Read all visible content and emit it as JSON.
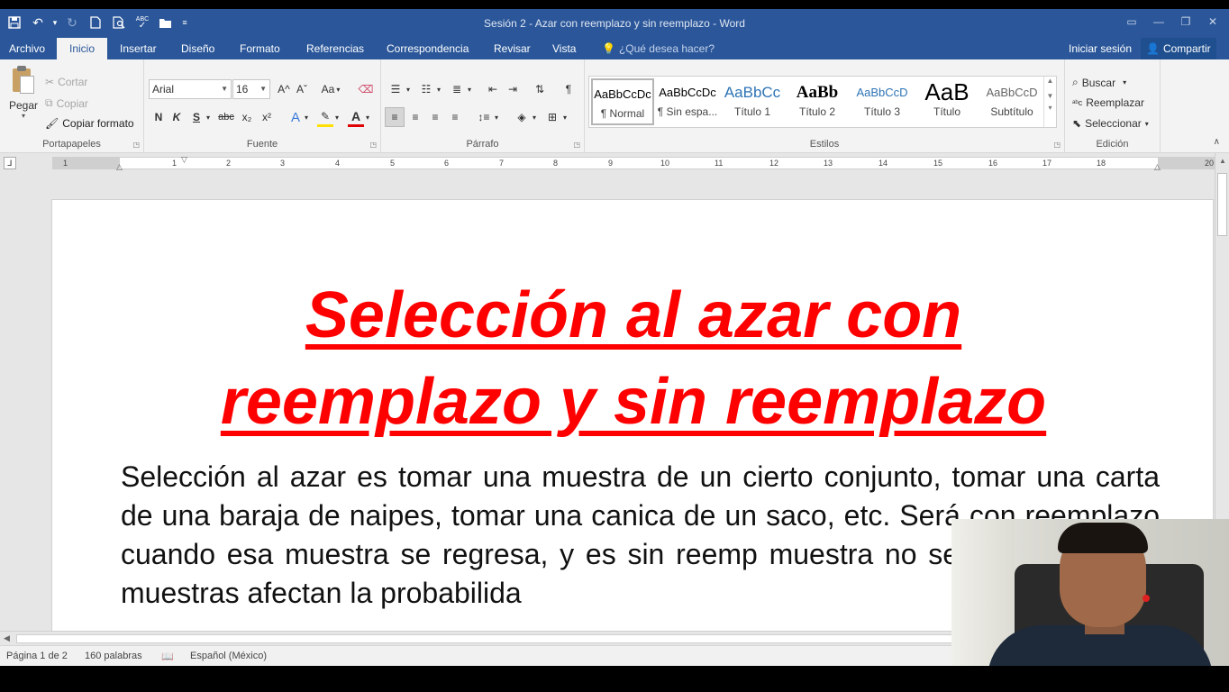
{
  "window": {
    "title": "Sesión 2 - Azar con reemplazo y sin reemplazo - Word"
  },
  "qat": {
    "icons": [
      "save-icon",
      "undo-icon",
      "redo-icon",
      "new-icon",
      "print-preview-icon",
      "spelling-icon",
      "open-icon",
      "customize-icon"
    ],
    "spelling_label": "ABC"
  },
  "tabs": [
    {
      "label": "Archivo"
    },
    {
      "label": "Inicio"
    },
    {
      "label": "Insertar"
    },
    {
      "label": "Diseño"
    },
    {
      "label": "Formato"
    },
    {
      "label": "Referencias"
    },
    {
      "label": "Correspondencia"
    },
    {
      "label": "Revisar"
    },
    {
      "label": "Vista"
    }
  ],
  "tellme": {
    "placeholder": "¿Qué desea hacer?"
  },
  "account": {
    "signin": "Iniciar sesión",
    "share": "Compartir"
  },
  "ribbon": {
    "clipboard": {
      "label": "Portapapeles",
      "paste": "Pegar",
      "cut": "Cortar",
      "copy": "Copiar",
      "format_painter": "Copiar formato"
    },
    "font": {
      "label": "Fuente",
      "family": "Arial",
      "size": "16",
      "bold": "N",
      "italic": "K",
      "underline": "S",
      "strike": "abc",
      "subscript": "x₂",
      "superscript": "x²",
      "grow": "A^",
      "shrink": "Aˇ",
      "change_case": "Aa",
      "effects": "A",
      "color": "A"
    },
    "paragraph": {
      "label": "Párrafo"
    },
    "styles": {
      "label": "Estilos",
      "items": [
        {
          "preview": "AaBbCcDc",
          "name": "¶ Normal"
        },
        {
          "preview": "AaBbCcDc",
          "name": "¶ Sin espa..."
        },
        {
          "preview": "AaBbCc",
          "name": "Título 1"
        },
        {
          "preview": "AaBb",
          "name": "Título 2"
        },
        {
          "preview": "AaBbCcD",
          "name": "Título 3"
        },
        {
          "preview": "AaB",
          "name": "Título"
        },
        {
          "preview": "AaBbCcD",
          "name": "Subtítulo"
        }
      ]
    },
    "editing": {
      "label": "Edición",
      "find": "Buscar",
      "replace": "Reemplazar",
      "select": "Seleccionar"
    }
  },
  "ruler": {
    "ticks": [
      "1",
      "1",
      "2",
      "3",
      "4",
      "5",
      "6",
      "7",
      "8",
      "9",
      "10",
      "11",
      "12",
      "13",
      "14",
      "15",
      "16",
      "17",
      "18",
      "20"
    ]
  },
  "document": {
    "heading_line1": "Selección al azar con",
    "heading_line2": "reemplazo y sin reemplazo",
    "body": "Selección al azar es tomar una muestra de un cierto conjunto, tomar una carta de una baraja de naipes, tomar una canica de un saco, etc. Será con reemplazo cuando esa muestra se regresa, y es sin reemp muestra no se regresa. Estas muestras afectan la probabilida"
  },
  "status": {
    "page": "Página 1 de 2",
    "words": "160 palabras",
    "language": "Español (México)"
  },
  "colors": {
    "brand": "#2b579a",
    "heading": "#ff0000"
  }
}
